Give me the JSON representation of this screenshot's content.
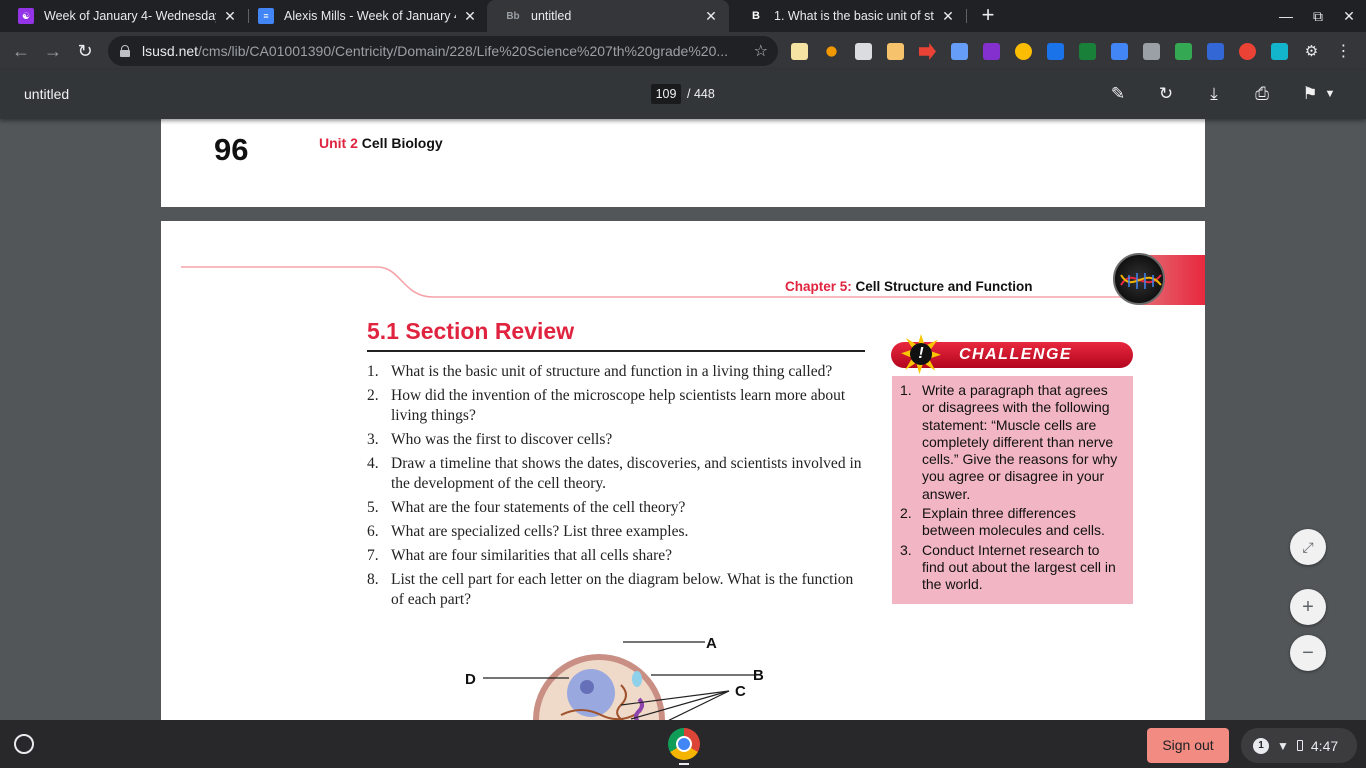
{
  "tabs": [
    {
      "title": "Week of January 4- Wednesday",
      "icon": "classroom-icon",
      "color": "#9334e6"
    },
    {
      "title": "Alexis Mills - Week of January 4-",
      "icon": "docs-icon",
      "color": "#4285f4"
    },
    {
      "title": "untitled",
      "icon": "blackboard-icon",
      "color": "#35363a"
    },
    {
      "title": "1. What is the basic unit of struc",
      "icon": "brainly-icon",
      "color": "#202124"
    }
  ],
  "address_bar": {
    "host": "lsusd.net",
    "path": "/cms/lib/CA01001390/Centricity/Domain/228/Life%20Science%207th%20grade%20..."
  },
  "pdf_viewer": {
    "title": "untitled",
    "current_page": "109",
    "total_pages": "/  448"
  },
  "document": {
    "page_number": "96",
    "unit_label": "Unit 2",
    "unit_title": "Cell Biology",
    "chapter_label": "Chapter 5:",
    "chapter_title": "Cell Structure and Function",
    "section_title": "5.1 Section Review",
    "questions": [
      {
        "num": "1.",
        "text": "What is the basic unit of structure and function in a living thing called?"
      },
      {
        "num": "2.",
        "text": "How did the invention of the microscope help scientists learn more about living things?"
      },
      {
        "num": "3.",
        "text": "Who was the first to discover cells?"
      },
      {
        "num": "4.",
        "text": "Draw a timeline that shows the dates, discoveries, and scientists involved in the development of the cell theory."
      },
      {
        "num": "5.",
        "text": "What are the four statements of the cell theory?"
      },
      {
        "num": "6.",
        "text": "What are specialized cells? List three examples."
      },
      {
        "num": "7.",
        "text": "What are four similarities that all cells share?"
      },
      {
        "num": "8.",
        "text": "List the cell part for each letter on the diagram below. What is the function of each part?"
      }
    ],
    "challenge_title": "CHALLENGE",
    "challenge_questions": [
      {
        "num": "1.",
        "text": "Write a paragraph that agrees or disagrees with the following statement: “Muscle cells are completely different than nerve cells.” Give the reasons for why you agree or disagree in your answer."
      },
      {
        "num": "2.",
        "text": "Explain three differences between molecules and cells."
      },
      {
        "num": "3.",
        "text": "Conduct Internet research to find out about the largest cell in the world."
      }
    ],
    "diagram_labels": {
      "a": "A",
      "b": "B",
      "c": "C",
      "d": "D"
    }
  },
  "shelf": {
    "sign_out_label": "Sign out",
    "notification_count": "1",
    "time": "4:47"
  },
  "colors": {
    "accent_red": "#e0243f",
    "challenge_bg": "#f1b5c3",
    "sign_out_bg": "#f28b82"
  }
}
